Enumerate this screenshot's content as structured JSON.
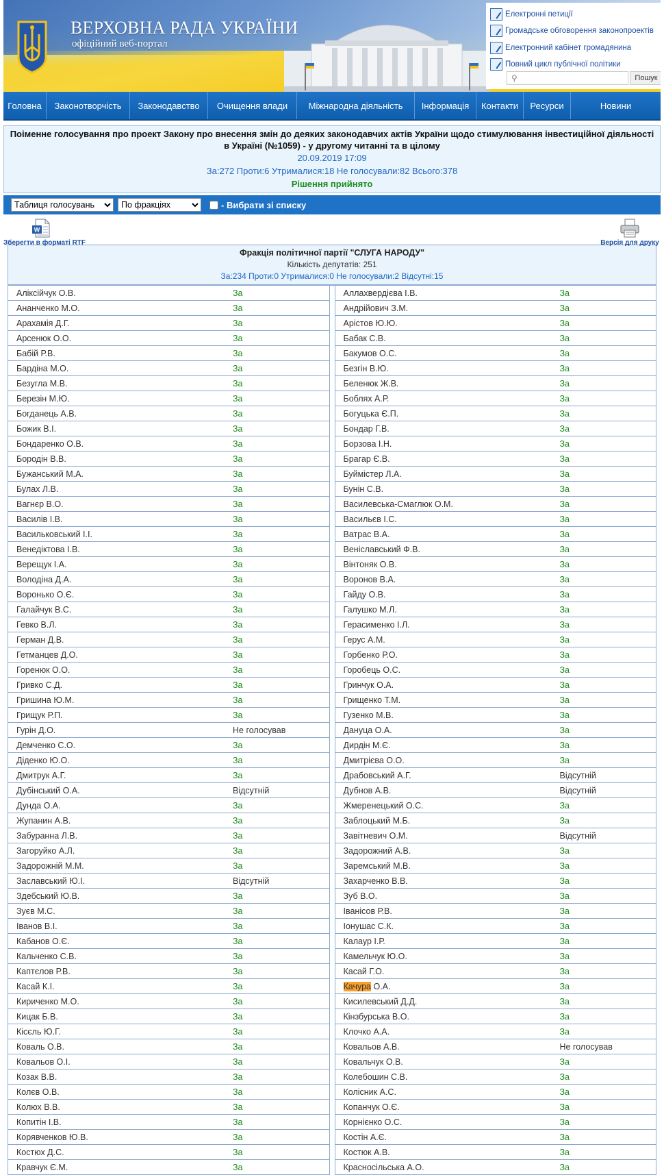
{
  "header": {
    "title": "ВЕРХОВНА РАДА УКРАЇНИ",
    "subtitle": "офіційний веб-портал",
    "quick_links": [
      "Електронні петиції",
      "Громадське обговорення законопроектів",
      "Електронний кабінет громадянина",
      "Повний цикл публічної політики"
    ],
    "search_placeholder": "",
    "search_button": "Пошук"
  },
  "nav": [
    "Головна",
    "Законотворчість",
    "Законодавство",
    "Очищення влади",
    "Міжнародна діяльність",
    "Інформація",
    "Контакти",
    "Ресурси",
    "Новини"
  ],
  "vote": {
    "title": "Поіменне голосування про проект Закону про внесення змін до деяких законодавчих актів України щодо стимулювання інвестиційної діяльності в Україні (№1059) - у другому читанні та в цілому",
    "date": "20.09.2019 17:09",
    "summary": "За:272 Проти:6 Утрималися:18 Не голосували:82 Всього:378",
    "result": "Рішення прийнято"
  },
  "toolbar": {
    "view_select": "Таблиця голосувань",
    "group_select": "По фракціях",
    "checkbox_label": "- Вибрати зі списку"
  },
  "actions": {
    "rtf": "Зберегти в форматі RTF",
    "print": "Версія для друку"
  },
  "faction": {
    "name": "Фракція політичної партії \"СЛУГА НАРОДУ\"",
    "count": "Кількість депутатів: 251",
    "totals": "За:234 Проти:0 Утрималися:0 Не голосували:2 Відсутні:15"
  },
  "rows": [
    [
      [
        "Аліксійчук О.В.",
        "За"
      ],
      [
        "Аллахвердієва І.В.",
        "За"
      ]
    ],
    [
      [
        "Ананченко М.О.",
        "За"
      ],
      [
        "Андрійович З.М.",
        "За"
      ]
    ],
    [
      [
        "Арахамія Д.Г.",
        "За"
      ],
      [
        "Арістов Ю.Ю.",
        "За"
      ]
    ],
    [
      [
        "Арсенюк О.О.",
        "За"
      ],
      [
        "Бабак С.В.",
        "За"
      ]
    ],
    [
      [
        "Бабій Р.В.",
        "За"
      ],
      [
        "Бакумов О.С.",
        "За"
      ]
    ],
    [
      [
        "Бардіна М.О.",
        "За"
      ],
      [
        "Безгін В.Ю.",
        "За"
      ]
    ],
    [
      [
        "Безугла М.В.",
        "За"
      ],
      [
        "Беленюк Ж.В.",
        "За"
      ]
    ],
    [
      [
        "Березін М.Ю.",
        "За"
      ],
      [
        "Боблях А.Р.",
        "За"
      ]
    ],
    [
      [
        "Богданець А.В.",
        "За"
      ],
      [
        "Богуцька Є.П.",
        "За"
      ]
    ],
    [
      [
        "Божик В.І.",
        "За"
      ],
      [
        "Бондар Г.В.",
        "За"
      ]
    ],
    [
      [
        "Бондаренко О.В.",
        "За"
      ],
      [
        "Борзова І.Н.",
        "За"
      ]
    ],
    [
      [
        "Бородін В.В.",
        "За"
      ],
      [
        "Брагар Є.В.",
        "За"
      ]
    ],
    [
      [
        "Бужанський М.А.",
        "За"
      ],
      [
        "Буймістер Л.А.",
        "За"
      ]
    ],
    [
      [
        "Булах Л.В.",
        "За"
      ],
      [
        "Бунін С.В.",
        "За"
      ]
    ],
    [
      [
        "Вагнєр В.О.",
        "За"
      ],
      [
        "Василевська-Смаглюк О.М.",
        "За"
      ]
    ],
    [
      [
        "Василів І.В.",
        "За"
      ],
      [
        "Васильєв І.С.",
        "За"
      ]
    ],
    [
      [
        "Васильковський І.І.",
        "За"
      ],
      [
        "Ватрас В.А.",
        "За"
      ]
    ],
    [
      [
        "Венедіктова І.В.",
        "За"
      ],
      [
        "Веніславський Ф.В.",
        "За"
      ]
    ],
    [
      [
        "Верещук І.А.",
        "За"
      ],
      [
        "Вінтоняк О.В.",
        "За"
      ]
    ],
    [
      [
        "Володіна Д.А.",
        "За"
      ],
      [
        "Воронов В.А.",
        "За"
      ]
    ],
    [
      [
        "Воронько О.Є.",
        "За"
      ],
      [
        "Гайду О.В.",
        "За"
      ]
    ],
    [
      [
        "Галайчук В.С.",
        "За"
      ],
      [
        "Галушко М.Л.",
        "За"
      ]
    ],
    [
      [
        "Гевко В.Л.",
        "За"
      ],
      [
        "Герасименко І.Л.",
        "За"
      ]
    ],
    [
      [
        "Герман Д.В.",
        "За"
      ],
      [
        "Герус А.М.",
        "За"
      ]
    ],
    [
      [
        "Гетманцев Д.О.",
        "За"
      ],
      [
        "Горбенко Р.О.",
        "За"
      ]
    ],
    [
      [
        "Горенюк О.О.",
        "За"
      ],
      [
        "Горобець О.С.",
        "За"
      ]
    ],
    [
      [
        "Гривко С.Д.",
        "За"
      ],
      [
        "Гринчук О.А.",
        "За"
      ]
    ],
    [
      [
        "Гришина Ю.М.",
        "За"
      ],
      [
        "Грищенко Т.М.",
        "За"
      ]
    ],
    [
      [
        "Грищук Р.П.",
        "За"
      ],
      [
        "Гузенко М.В.",
        "За"
      ]
    ],
    [
      [
        "Гурін Д.О.",
        "Не голосував"
      ],
      [
        "Дануца О.А.",
        "За"
      ]
    ],
    [
      [
        "Демченко С.О.",
        "За"
      ],
      [
        "Дирдін М.Є.",
        "За"
      ]
    ],
    [
      [
        "Діденко Ю.О.",
        "За"
      ],
      [
        "Дмитрієва О.О.",
        "За"
      ]
    ],
    [
      [
        "Дмитрук А.Г.",
        "За"
      ],
      [
        "Драбовський А.Г.",
        "Відсутній"
      ]
    ],
    [
      [
        "Дубінський О.А.",
        "Відсутній"
      ],
      [
        "Дубнов А.В.",
        "Відсутній"
      ]
    ],
    [
      [
        "Дунда О.А.",
        "За"
      ],
      [
        "Жмеренецький О.С.",
        "За"
      ]
    ],
    [
      [
        "Жупанин А.В.",
        "За"
      ],
      [
        "Заблоцький М.Б.",
        "За"
      ]
    ],
    [
      [
        "Забуранна Л.В.",
        "За"
      ],
      [
        "Завітневич О.М.",
        "Відсутній"
      ]
    ],
    [
      [
        "Загоруйко А.Л.",
        "За"
      ],
      [
        "Задорожний А.В.",
        "За"
      ]
    ],
    [
      [
        "Задорожній М.М.",
        "За"
      ],
      [
        "Заремський М.В.",
        "За"
      ]
    ],
    [
      [
        "Заславський Ю.І.",
        "Відсутній"
      ],
      [
        "Захарченко В.В.",
        "За"
      ]
    ],
    [
      [
        "Здебський Ю.В.",
        "За"
      ],
      [
        "Зуб В.О.",
        "За"
      ]
    ],
    [
      [
        "Зуєв М.С.",
        "За"
      ],
      [
        "Іванісов Р.В.",
        "За"
      ]
    ],
    [
      [
        "Іванов В.І.",
        "За"
      ],
      [
        "Іонушас С.К.",
        "За"
      ]
    ],
    [
      [
        "Кабанов О.Є.",
        "За"
      ],
      [
        "Калаур І.Р.",
        "За"
      ]
    ],
    [
      [
        "Кальченко С.В.",
        "За"
      ],
      [
        "Камельчук Ю.О.",
        "За"
      ]
    ],
    [
      [
        "Каптєлов Р.В.",
        "За"
      ],
      [
        "Касай Г.О.",
        "За"
      ]
    ],
    [
      [
        "Касай К.І.",
        "За"
      ],
      [
        "Качура О.А.",
        "За"
      ]
    ],
    [
      [
        "Кириченко М.О.",
        "За"
      ],
      [
        "Кисилевський Д.Д.",
        "За"
      ]
    ],
    [
      [
        "Кицак Б.В.",
        "За"
      ],
      [
        "Кінзбурська В.О.",
        "За"
      ]
    ],
    [
      [
        "Кісєль Ю.Г.",
        "За"
      ],
      [
        "Клочко А.А.",
        "За"
      ]
    ],
    [
      [
        "Коваль О.В.",
        "За"
      ],
      [
        "Ковальов А.В.",
        "Не голосував"
      ]
    ],
    [
      [
        "Ковальов О.І.",
        "За"
      ],
      [
        "Ковальчук О.В.",
        "За"
      ]
    ],
    [
      [
        "Козак В.В.",
        "За"
      ],
      [
        "Колебошин С.В.",
        "За"
      ]
    ],
    [
      [
        "Колєв О.В.",
        "За"
      ],
      [
        "Колісник А.С.",
        "За"
      ]
    ],
    [
      [
        "Колюх В.В.",
        "За"
      ],
      [
        "Копанчук О.Є.",
        "За"
      ]
    ],
    [
      [
        "Копитін І.В.",
        "За"
      ],
      [
        "Корнієнко О.С.",
        "За"
      ]
    ],
    [
      [
        "Корявченков Ю.В.",
        "За"
      ],
      [
        "Костін А.Є.",
        "За"
      ]
    ],
    [
      [
        "Костюх Д.С.",
        "За"
      ],
      [
        "Костюк А.В.",
        "За"
      ]
    ],
    [
      [
        "Кравчук Є.М.",
        "За"
      ],
      [
        "Красносільська А.О.",
        "За"
      ]
    ]
  ],
  "highlight": {
    "row": 46,
    "side": 1,
    "part": "Качура",
    "rest": " О.А."
  },
  "colors": {
    "nav_blue": "#1e73c7",
    "vote_green": "#1c8c1c",
    "info_blue": "#1f67c2",
    "highlight": "#f9a12b"
  }
}
